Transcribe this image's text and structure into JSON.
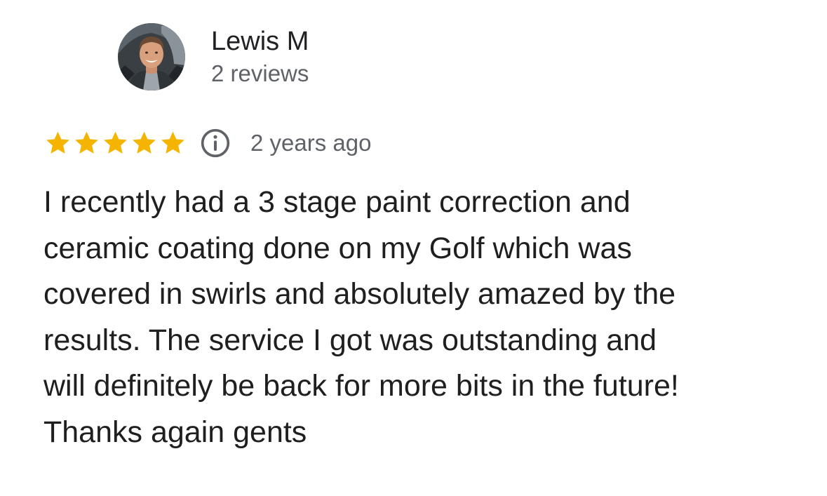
{
  "reviewer": {
    "name": "Lewis M",
    "reviews_count": "2 reviews",
    "avatar_icon": "profile-photo"
  },
  "rating": {
    "stars": 5,
    "max_stars": 5,
    "star_color": "#F4B400",
    "info_icon": "info-circle-icon",
    "date": "2 years ago"
  },
  "review": {
    "text": "I recently had a 3 stage paint correction and\nceramic coating done on my Golf which was\ncovered in swirls and absolutely amazed by the\nresults. The service I got was outstanding and\nwill definitely be back for more bits in the future!\nThanks again gents"
  }
}
